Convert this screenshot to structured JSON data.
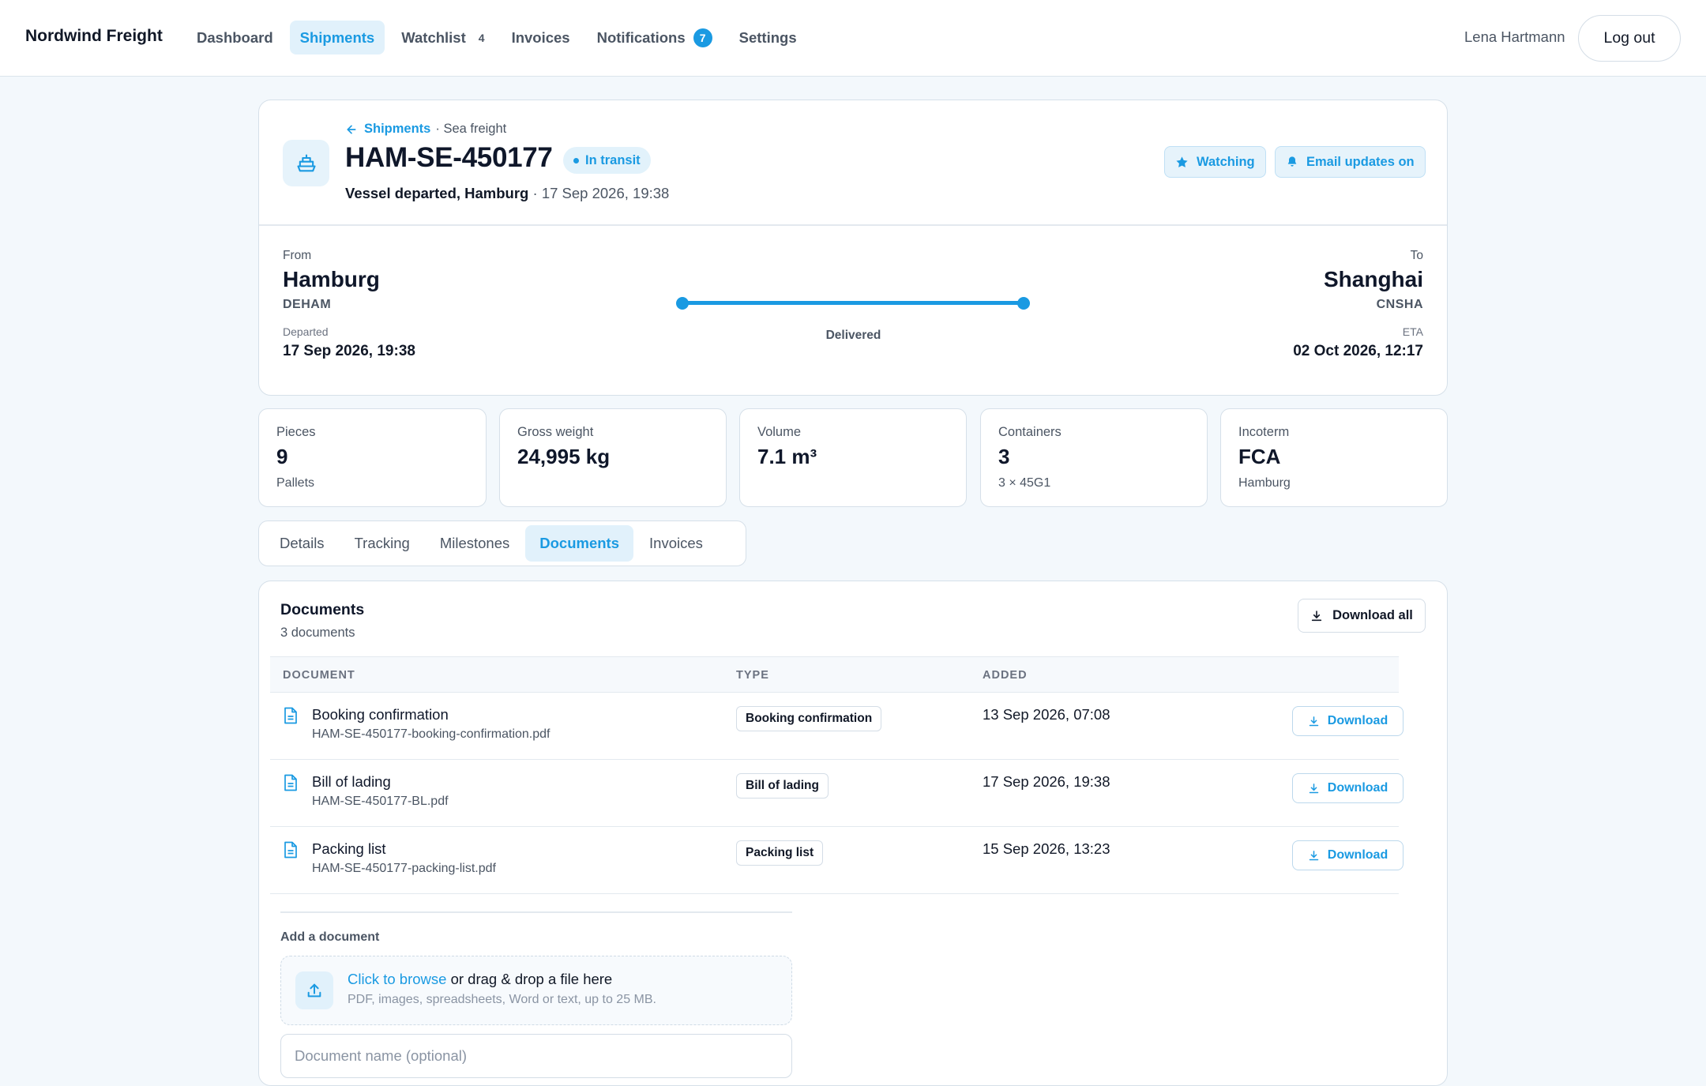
{
  "app": {
    "brand": "Nordwind Freight"
  },
  "nav": {
    "items": [
      {
        "label": "Dashboard"
      },
      {
        "label": "Shipments",
        "active": true
      },
      {
        "label": "Watchlist",
        "count": "4"
      },
      {
        "label": "Invoices"
      },
      {
        "label": "Notifications",
        "badge": "7"
      },
      {
        "label": "Settings"
      }
    ],
    "user": "Lena Hartmann",
    "logout": "Log out"
  },
  "shipment": {
    "breadcrumb": {
      "link": "Shipments",
      "sub": "· Sea freight"
    },
    "id": "HAM-SE-450177",
    "status": "In transit",
    "latest_event": "Vessel departed, Hamburg",
    "latest_time": "· 17 Sep 2026, 19:38",
    "watching_label": "Watching",
    "email_label": "Email updates on",
    "origin": {
      "label": "From",
      "city": "Hamburg",
      "code": "DEHAM",
      "date_label": "Departed",
      "date": "17 Sep 2026, 19:38"
    },
    "destination": {
      "label": "To",
      "city": "Shanghai",
      "code": "CNSHA",
      "date_label": "ETA",
      "date": "02 Oct 2026, 12:17"
    },
    "route_status": "Delivered",
    "route_progress": 1.0
  },
  "stats": [
    {
      "label": "Pieces",
      "value": "9",
      "sub": "Pallets"
    },
    {
      "label": "Gross weight",
      "value": "24,995 kg",
      "sub": ""
    },
    {
      "label": "Volume",
      "value": "7.1 m³",
      "sub": ""
    },
    {
      "label": "Containers",
      "value": "3",
      "sub": "3 × 45G1"
    },
    {
      "label": "Incoterm",
      "value": "FCA",
      "sub": "Hamburg"
    }
  ],
  "tabs": [
    {
      "label": "Details"
    },
    {
      "label": "Tracking"
    },
    {
      "label": "Milestones"
    },
    {
      "label": "Documents",
      "active": true
    },
    {
      "label": "Invoices"
    }
  ],
  "documents": {
    "title": "Documents",
    "count": "3 documents",
    "download_all": "Download all",
    "columns": {
      "document": "DOCUMENT",
      "type": "TYPE",
      "added": "ADDED"
    },
    "rows": [
      {
        "name": "Booking confirmation",
        "file": "HAM-SE-450177-booking-confirmation.pdf",
        "type": "Booking confirmation",
        "added": "13 Sep 2026, 07:08",
        "action": "Download"
      },
      {
        "name": "Bill of lading",
        "file": "HAM-SE-450177-BL.pdf",
        "type": "Bill of lading",
        "added": "17 Sep 2026, 19:38",
        "action": "Download"
      },
      {
        "name": "Packing list",
        "file": "HAM-SE-450177-packing-list.pdf",
        "type": "Packing list",
        "added": "15 Sep 2026, 13:23",
        "action": "Download"
      }
    ],
    "add": {
      "title": "Add a document",
      "browse": "Click to browse",
      "drag": " or drag & drop a file here",
      "hint": "PDF, images, spreadsheets, Word or text, up to 25 MB.",
      "name_placeholder": "Document name (optional)"
    }
  },
  "icons": {
    "ship": "ship-icon",
    "back": "arrow-left-icon",
    "star": "star-icon",
    "bell": "bell-icon",
    "download": "download-icon",
    "file": "file-icon",
    "upload": "upload-icon"
  },
  "colors": {
    "accent": "#1a9ae2",
    "background": "#f3f8fc"
  }
}
